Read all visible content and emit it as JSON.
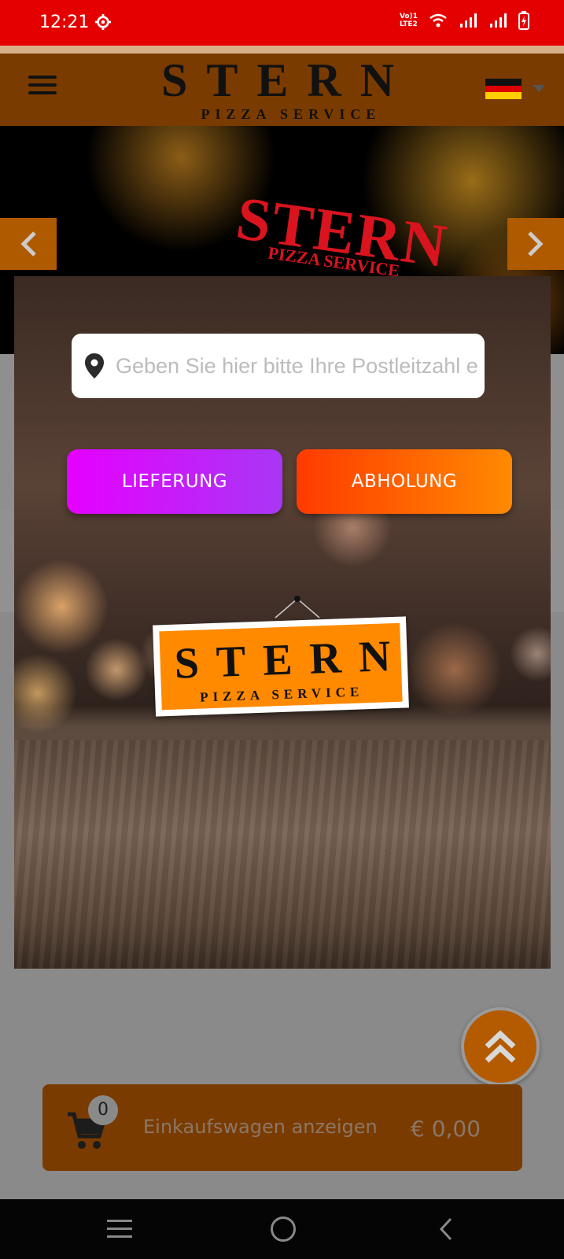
{
  "status_bar": {
    "time": "12:21",
    "volte_line1": "Vo)1",
    "volte_line2": "LTE2"
  },
  "header": {
    "logo_title": "STERN",
    "logo_subtitle": "PIZZA SERVICE",
    "language_flag": "germany-flag"
  },
  "hero": {
    "logo_title": "STERN",
    "logo_subtitle": "PIZZA SERVICE"
  },
  "modal": {
    "zip_placeholder": "Geben Sie hier bitte Ihre Postleitzahl ein",
    "delivery_label": "LIEFERUNG",
    "pickup_label": "ABHOLUNG",
    "sign_title": "STERN",
    "sign_subtitle": "PIZZA SERVICE"
  },
  "cart": {
    "count": "0",
    "label": "Einkaufswagen anzeigen",
    "total": "€ 0,00"
  },
  "colors": {
    "brand_brown": "#7a3b00",
    "status_red": "#e50000",
    "delivery_gradient": [
      "#e600ff",
      "#a837f5"
    ],
    "pickup_gradient": [
      "#ff3a00",
      "#ff8a00"
    ]
  },
  "icons": [
    "gear-icon",
    "wifi-icon",
    "signal-icon",
    "battery-icon",
    "menu-icon",
    "chevron-left-icon",
    "chevron-right-icon",
    "location-pin-icon",
    "double-chevron-up-icon",
    "cart-icon",
    "nav-menu-icon",
    "nav-home-icon",
    "nav-back-icon"
  ]
}
